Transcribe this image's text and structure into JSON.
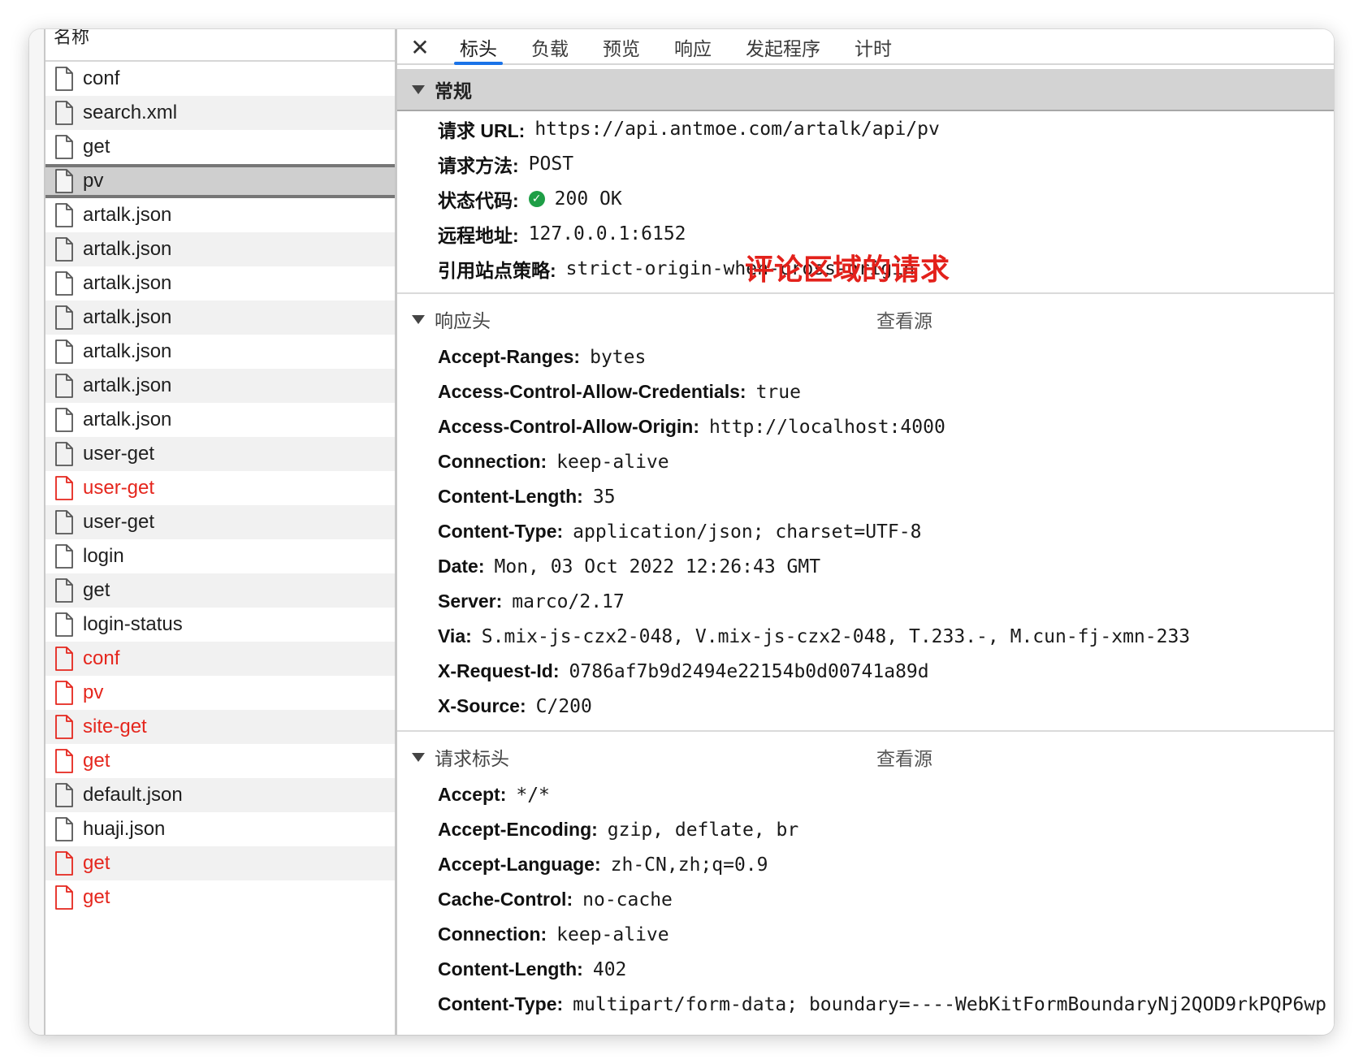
{
  "list": {
    "header": "名称",
    "rows": [
      {
        "name": "conf",
        "error": false
      },
      {
        "name": "search.xml",
        "error": false
      },
      {
        "name": "get",
        "error": false
      },
      {
        "name": "pv",
        "error": false,
        "selected": true
      },
      {
        "name": "artalk.json",
        "error": false
      },
      {
        "name": "artalk.json",
        "error": false
      },
      {
        "name": "artalk.json",
        "error": false
      },
      {
        "name": "artalk.json",
        "error": false
      },
      {
        "name": "artalk.json",
        "error": false
      },
      {
        "name": "artalk.json",
        "error": false
      },
      {
        "name": "artalk.json",
        "error": false
      },
      {
        "name": "user-get",
        "error": false
      },
      {
        "name": "user-get",
        "error": true
      },
      {
        "name": "user-get",
        "error": false
      },
      {
        "name": "login",
        "error": false
      },
      {
        "name": "get",
        "error": false
      },
      {
        "name": "login-status",
        "error": false
      },
      {
        "name": "conf",
        "error": true
      },
      {
        "name": "pv",
        "error": true
      },
      {
        "name": "site-get",
        "error": true
      },
      {
        "name": "get",
        "error": true
      },
      {
        "name": "default.json",
        "error": false
      },
      {
        "name": "huaji.json",
        "error": false
      },
      {
        "name": "get",
        "error": true
      },
      {
        "name": "get",
        "error": true
      }
    ]
  },
  "tabs": {
    "close_icon": "close-icon",
    "items": [
      "标头",
      "负载",
      "预览",
      "响应",
      "发起程序",
      "计时"
    ],
    "active": "标头"
  },
  "general": {
    "title": "常规",
    "fields": [
      {
        "key": "请求 URL:",
        "value": "https://api.antmoe.com/artalk/api/pv"
      },
      {
        "key": "请求方法:",
        "value": "POST"
      },
      {
        "key": "状态代码:",
        "value": "200 OK",
        "status_icon": "check-circle-icon"
      },
      {
        "key": "远程地址:",
        "value": "127.0.0.1:6152"
      },
      {
        "key": "引用站点策略:",
        "value": "strict-origin-when-cross-origin"
      }
    ],
    "annotation": "评论区域的请求"
  },
  "response_headers": {
    "title": "响应头",
    "view_source": "查看源",
    "fields": [
      {
        "key": "Accept-Ranges:",
        "value": "bytes"
      },
      {
        "key": "Access-Control-Allow-Credentials:",
        "value": "true"
      },
      {
        "key": "Access-Control-Allow-Origin:",
        "value": "http://localhost:4000"
      },
      {
        "key": "Connection:",
        "value": "keep-alive"
      },
      {
        "key": "Content-Length:",
        "value": "35"
      },
      {
        "key": "Content-Type:",
        "value": "application/json; charset=UTF-8"
      },
      {
        "key": "Date:",
        "value": "Mon, 03 Oct 2022 12:26:43 GMT"
      },
      {
        "key": "Server:",
        "value": "marco/2.17"
      },
      {
        "key": "Via:",
        "value": "S.mix-js-czx2-048, V.mix-js-czx2-048, T.233.-, M.cun-fj-xmn-233"
      },
      {
        "key": "X-Request-Id:",
        "value": "0786af7b9d2494e22154b0d00741a89d"
      },
      {
        "key": "X-Source:",
        "value": "C/200"
      }
    ]
  },
  "request_headers": {
    "title": "请求标头",
    "view_source": "查看源",
    "fields": [
      {
        "key": "Accept:",
        "value": "*/*"
      },
      {
        "key": "Accept-Encoding:",
        "value": "gzip, deflate, br"
      },
      {
        "key": "Accept-Language:",
        "value": "zh-CN,zh;q=0.9"
      },
      {
        "key": "Cache-Control:",
        "value": "no-cache"
      },
      {
        "key": "Connection:",
        "value": "keep-alive"
      },
      {
        "key": "Content-Length:",
        "value": "402"
      },
      {
        "key": "Content-Type:",
        "value": "multipart/form-data; boundary=----WebKitFormBoundaryNj2QOD9rkPQP6wp"
      }
    ]
  },
  "colors": {
    "error": "#e5261d",
    "accent": "#1a73e8",
    "ok": "#1e9e46",
    "annotation": "#e3211b"
  }
}
